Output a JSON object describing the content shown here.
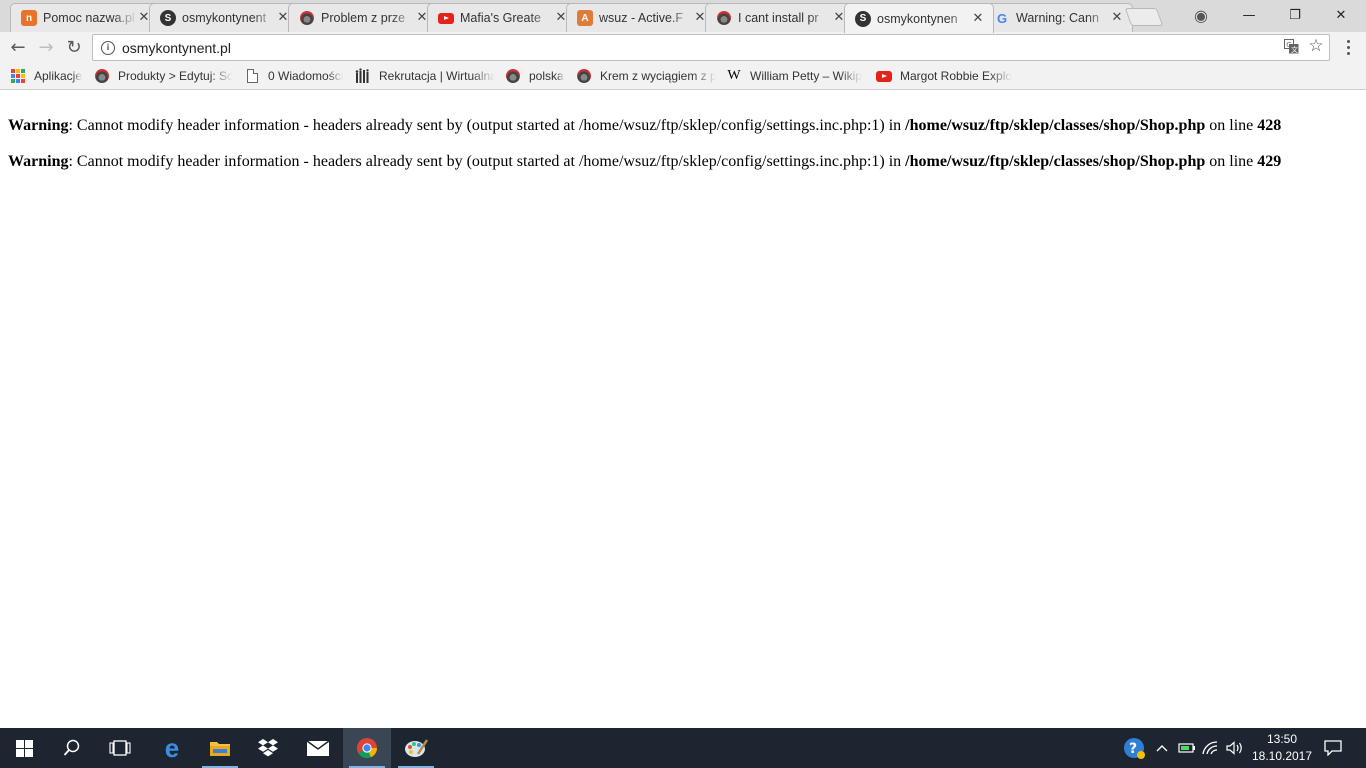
{
  "browser": {
    "tabs": [
      {
        "title": "Pomoc nazwa.pl",
        "icon": "nazwa-icon",
        "color": "#e8732a",
        "active": false
      },
      {
        "title": "osmykontynent",
        "icon": "s-letter-icon",
        "color": "#333333",
        "active": false
      },
      {
        "title": "Problem z prze",
        "icon": "rider-icon",
        "color": "#666666",
        "active": false
      },
      {
        "title": "Mafia's Greate",
        "icon": "youtube-icon",
        "color": "#e62117",
        "active": false
      },
      {
        "title": "wsuz - Active.F",
        "icon": "active-icon",
        "color": "#e07b39",
        "active": false
      },
      {
        "title": "I cant install pr",
        "icon": "rider-icon",
        "color": "#666666",
        "active": false
      },
      {
        "title": "osmykontynen",
        "icon": "s-letter-icon",
        "color": "#333333",
        "active": true
      },
      {
        "title": "Warning: Cann",
        "icon": "google-icon",
        "color": "#4285f4",
        "active": false
      }
    ],
    "window_controls": {
      "profile": "◉",
      "minimize": "—",
      "maximize": "❐",
      "close": "✕"
    }
  },
  "toolbar": {
    "back": "←",
    "forward": "→",
    "reload": "↻",
    "url": "osmykontynent.pl",
    "translate": "⌨",
    "star": "☆"
  },
  "bookmarks": [
    {
      "label": "Aplikacje",
      "icon": "apps-grid-icon"
    },
    {
      "label": "Produkty > Edytuj: Sc",
      "icon": "rider-icon"
    },
    {
      "label": "0 Wiadomości",
      "icon": "page-icon"
    },
    {
      "label": "Rekrutacja | Wirtualna",
      "icon": "people-icon"
    },
    {
      "label": "polska",
      "icon": "rider-icon"
    },
    {
      "label": "Krem z wyciągiem z p",
      "icon": "rider-icon"
    },
    {
      "label": "William Petty – Wikip",
      "icon": "wikipedia-icon"
    },
    {
      "label": "Margot Robbie Explo",
      "icon": "youtube-icon"
    }
  ],
  "page": {
    "warnings": [
      {
        "label": "Warning",
        "message": ": Cannot modify header information - headers already sent by (output started at /home/wsuz/ftp/sklep/config/settings.inc.php:1) in ",
        "file": "/home/wsuz/ftp/sklep/classes/shop/Shop.php",
        "on_line": " on line ",
        "line": "428"
      },
      {
        "label": "Warning",
        "message": ": Cannot modify header information - headers already sent by (output started at /home/wsuz/ftp/sklep/config/settings.inc.php:1) in ",
        "file": "/home/wsuz/ftp/sklep/classes/shop/Shop.php",
        "on_line": " on line ",
        "line": "429"
      }
    ]
  },
  "taskbar": {
    "clock_time": "13:50",
    "clock_date": "18.10.2017"
  }
}
